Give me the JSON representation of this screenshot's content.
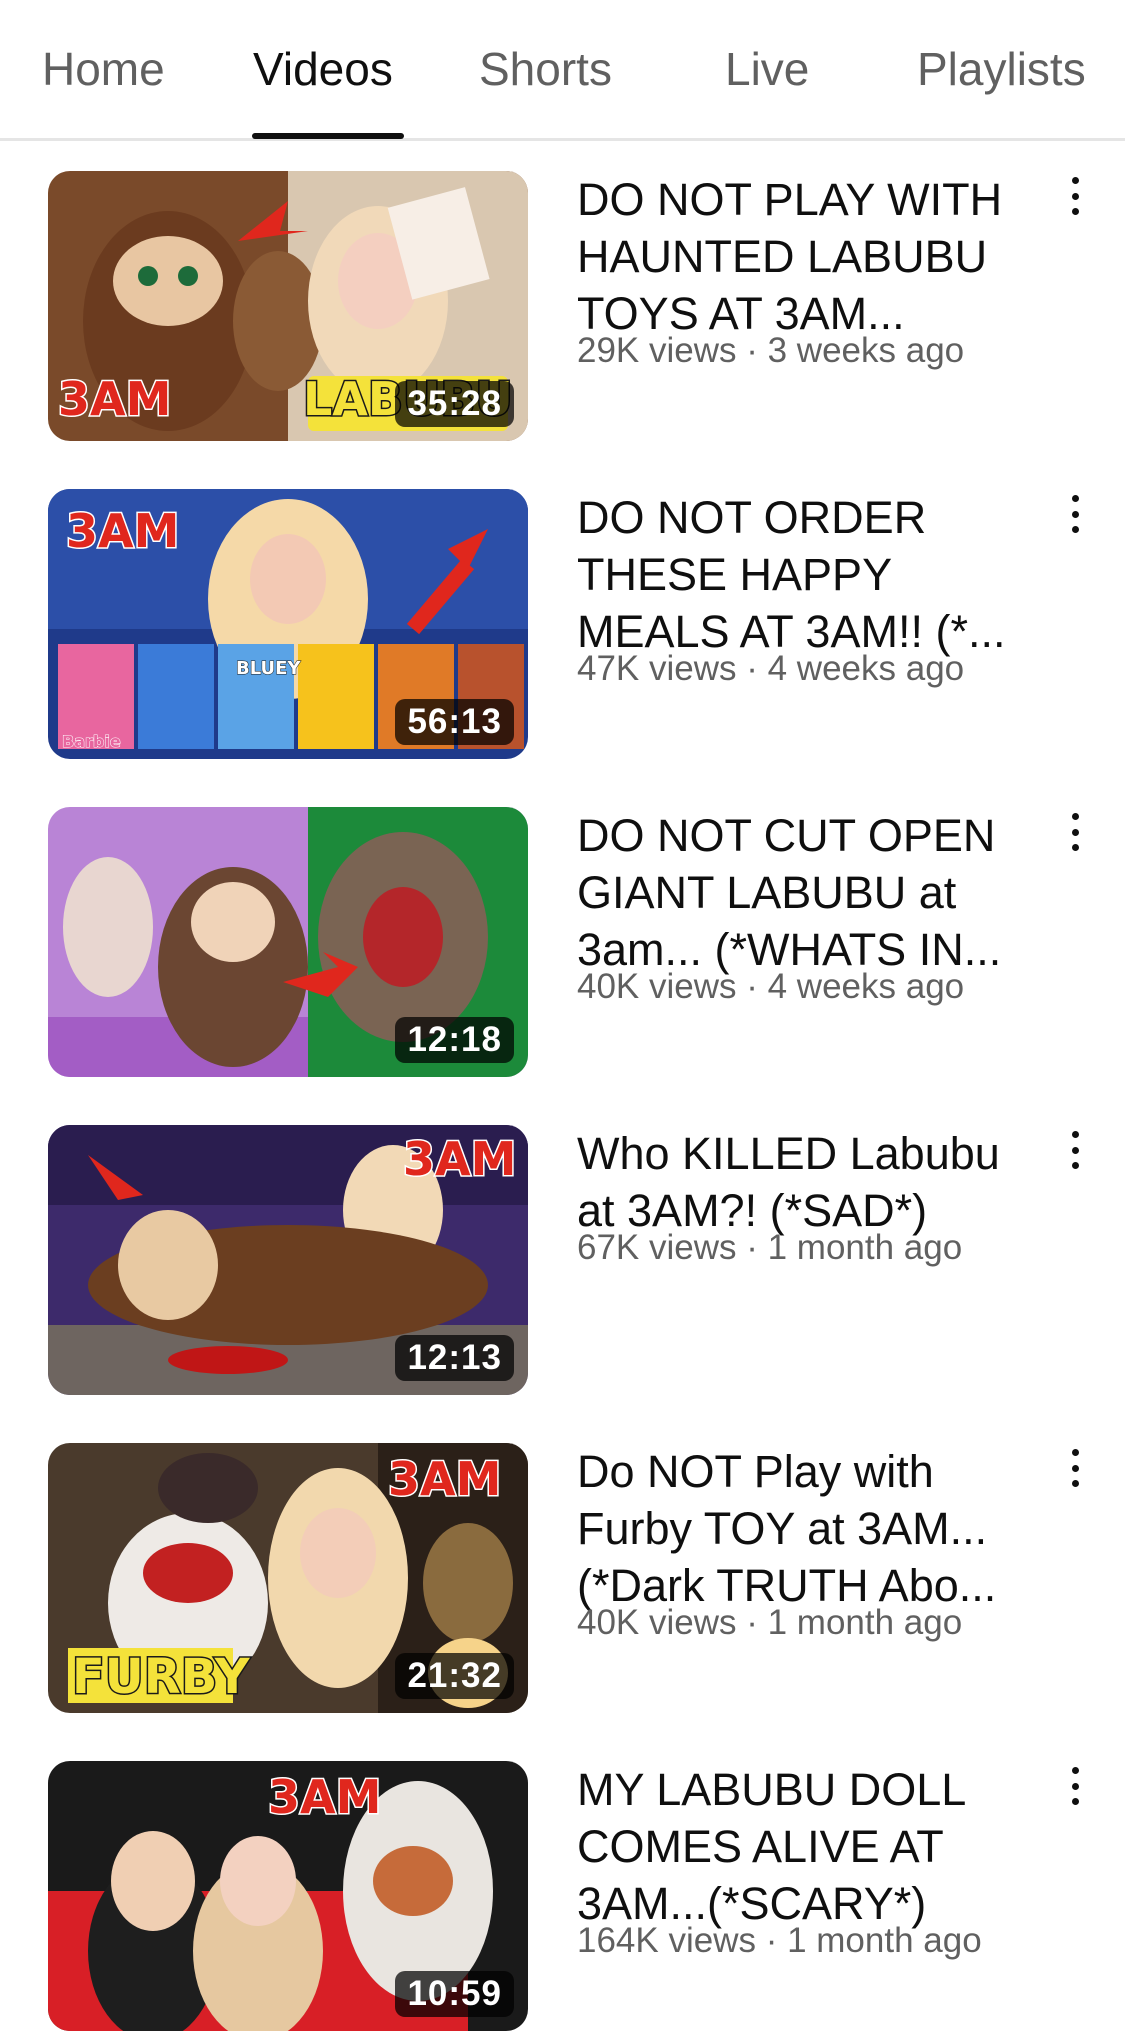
{
  "tabs": [
    {
      "label": "Home",
      "active": false
    },
    {
      "label": "Videos",
      "active": true
    },
    {
      "label": "Shorts",
      "active": false
    },
    {
      "label": "Live",
      "active": false
    },
    {
      "label": "Playlists",
      "active": false
    }
  ],
  "videos": [
    {
      "title": "DO NOT PLAY WITH HAUNTED LABUBU TOYS AT 3AM...",
      "meta": "29K views · 3 weeks ago",
      "duration": "35:28",
      "thumb_text": [
        "3AM",
        "LABUBU"
      ]
    },
    {
      "title": "DO NOT ORDER THESE HAPPY MEALS AT 3AM!! (*...",
      "meta": "47K views · 4 weeks ago",
      "duration": "56:13",
      "thumb_text": [
        "3AM",
        "BLUEY",
        "Barbie"
      ]
    },
    {
      "title": "DO NOT CUT OPEN GIANT LABUBU at 3am... (*WHATS IN...",
      "meta": "40K views · 4 weeks ago",
      "duration": "12:18",
      "thumb_text": []
    },
    {
      "title": "Who KILLED Labubu at 3AM?! (*SAD*)",
      "meta": "67K views · 1 month ago",
      "duration": "12:13",
      "thumb_text": [
        "3AM"
      ]
    },
    {
      "title": "Do NOT Play with Furby TOY at 3AM... (*Dark TRUTH Abo...",
      "meta": "40K views · 1 month ago",
      "duration": "21:32",
      "thumb_text": [
        "3AM",
        "FURBY"
      ]
    },
    {
      "title": "MY LABUBU DOLL COMES ALIVE AT 3AM...(*SCARY*)",
      "meta": "164K views · 1 month ago",
      "duration": "10:59",
      "thumb_text": [
        "3AM"
      ]
    }
  ],
  "colors": {
    "text_primary": "#0f0f0f",
    "text_secondary": "#606060",
    "divider": "#e5e5e5"
  },
  "icons": {
    "menu": "more-vertical-icon"
  }
}
